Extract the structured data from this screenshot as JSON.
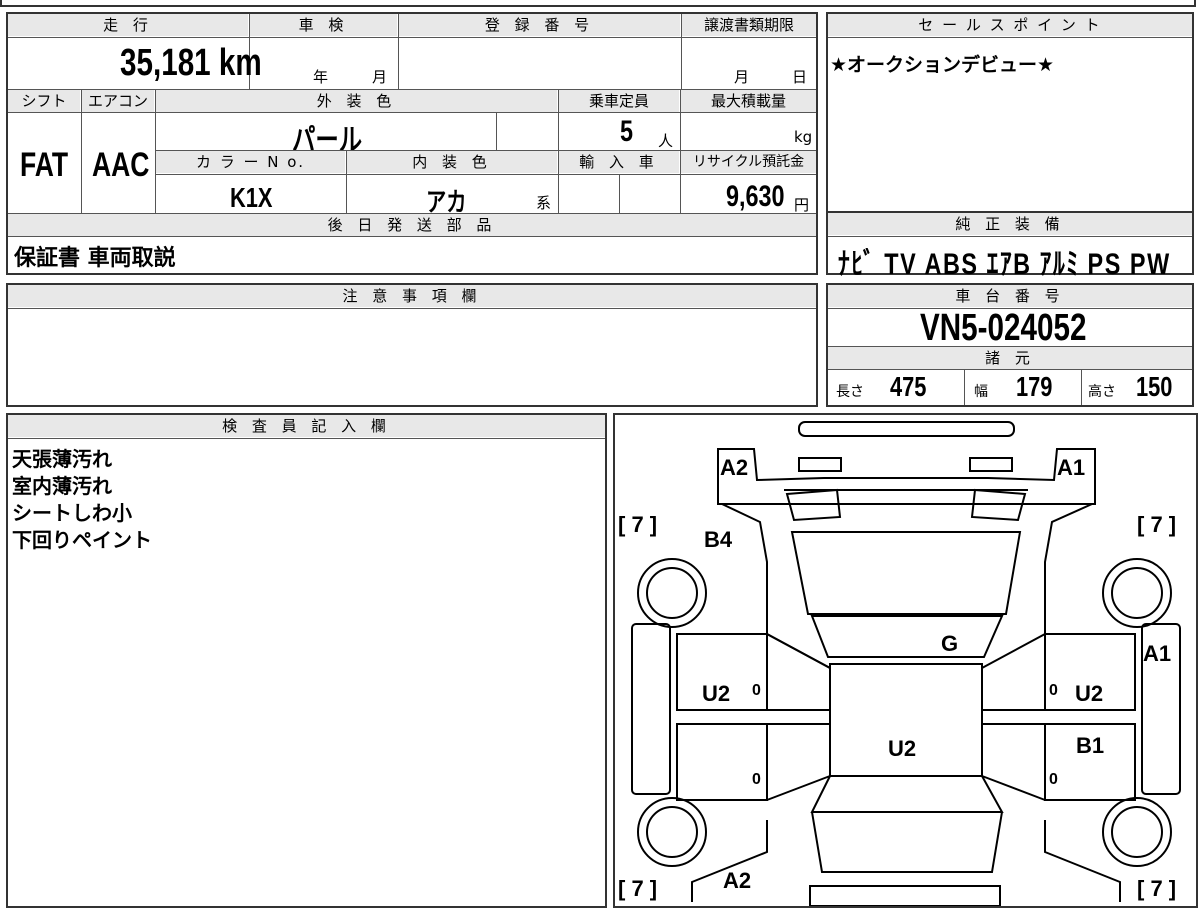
{
  "basic": {
    "h_mileage": "走 行",
    "h_inspection": "車 検",
    "h_registration": "登 録 番 号",
    "h_transfer": "譲渡書類期限",
    "mileage": "35,181 km",
    "insp_year": "年",
    "insp_month": "月",
    "transfer_month": "月",
    "transfer_day": "日",
    "h_shift": "シフト",
    "h_ac": "エアコン",
    "h_exterior": "外 装 色",
    "h_capacity": "乗車定員",
    "h_maxload": "最大積載量",
    "shift": "FAT",
    "ac": "AAC",
    "exterior": "パール",
    "capacity": "5",
    "capacity_unit": "人",
    "maxload_unit": "kg",
    "h_colorno": "カ ラ ー N o.",
    "h_interior": "内 装 色",
    "h_import": "輸 入 車",
    "h_recycle": "リサイクル預託金",
    "colorno": "K1X",
    "interior": "アカ",
    "interior_suffix": "系",
    "recycle": "9,630",
    "recycle_unit": "円",
    "h_later": "後 日 発 送 部 品",
    "later": "保証書 車両取説"
  },
  "sales": {
    "h": "セ ー ル ス ポ イ ン ト",
    "text": "★オークションデビュー★"
  },
  "equipment": {
    "h": "純 正 装 備",
    "items": "ﾅﾋﾞ TV ABS ｴｱB ｱﾙﾐ PS PW"
  },
  "notes": {
    "h": "注 意 事 項 欄"
  },
  "chassis": {
    "h": "車 台 番 号",
    "value": "VN5-024052"
  },
  "specs": {
    "h": "諸 元",
    "length_label": "長さ",
    "length": "475",
    "width_label": "幅",
    "width": "179",
    "height_label": "高さ",
    "height": "150"
  },
  "inspector": {
    "h": "検 査 員 記 入 欄",
    "lines": [
      "天張薄汚れ",
      "室内薄汚れ",
      "シートしわ小",
      "下回りペイント"
    ]
  },
  "diagram": {
    "marks": {
      "front_left": "A2",
      "front_right": "A1",
      "b4": "B4",
      "glass": "G",
      "left_front_door": "U2",
      "right_front_door": "U2",
      "roof": "U2",
      "right_fender": "A1",
      "right_rear_door": "B1",
      "rear": "A2",
      "zero": "0"
    },
    "tread": "[ 7 ]"
  }
}
